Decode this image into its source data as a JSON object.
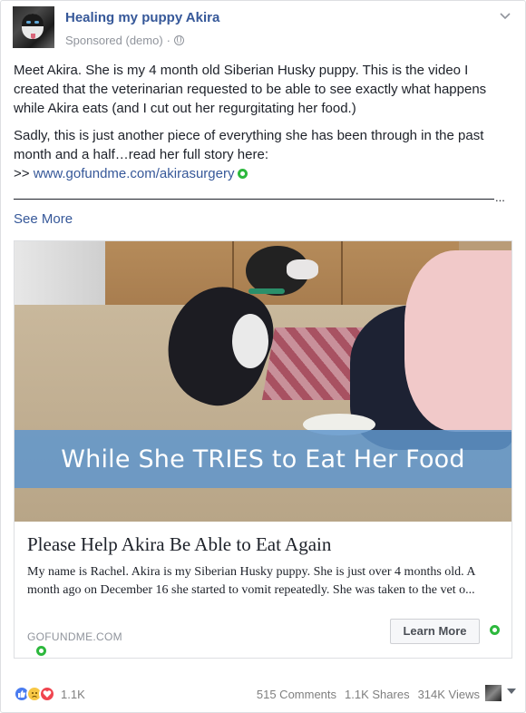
{
  "header": {
    "page_name": "Healing my puppy Akira",
    "sponsored_label": "Sponsored (demo)",
    "separator": "·",
    "avatar_icon": "husky-puppy-avatar",
    "privacy_icon": "globe-icon",
    "menu_icon": "chevron-down-icon"
  },
  "post": {
    "paragraph_1": "Meet Akira. She is my 4 month old Siberian Husky puppy. This is the video I created that the veterinarian requested to be able to see exactly what happens while Akira eats (and I cut out her regurgitating her food.)",
    "paragraph_2": "Sadly, this is just another piece of everything she has been through in the past month and a half…read her full story here:",
    "link_prefix": ">>",
    "link_text": "www.gofundme.com/akirasurgery",
    "ellipsis": "...",
    "see_more": "See More"
  },
  "attachment": {
    "video_caption": "While She TRIES to Eat Her Food",
    "title": "Please Help Akira Be Able to Eat Again",
    "description": "My name is Rachel. Akira is my Siberian Husky puppy. She is just over 4 months old. A month ago on December 16 she started to vomit repeatedly. She was taken to the vet o...",
    "domain": "GOFUNDME.COM",
    "cta_label": "Learn More"
  },
  "footer": {
    "reaction_icons": [
      "like-icon",
      "sad-icon",
      "love-icon"
    ],
    "reaction_count": "1.1K",
    "comments": "515 Comments",
    "shares": "1.1K Shares",
    "views": "314K Views"
  },
  "colors": {
    "link_blue": "#365899",
    "marker_green": "#2db83d",
    "caption_band": "#6096cd"
  }
}
